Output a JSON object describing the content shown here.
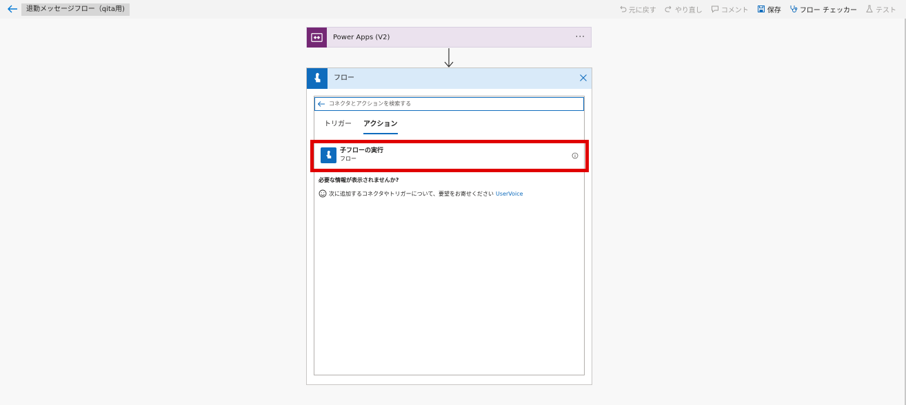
{
  "header": {
    "flow_name": "退勤メッセージフロー（qita用)",
    "toolbar": {
      "undo": "元に戻す",
      "redo": "やり直し",
      "comment": "コメント",
      "save": "保存",
      "flow_checker": "フロー チェッカー",
      "test": "テスト"
    }
  },
  "trigger_card": {
    "title": "Power Apps (V2)",
    "more": "···"
  },
  "flow_panel": {
    "title": "フロー",
    "search_placeholder": "コネクタとアクションを検索する",
    "tabs": [
      "トリガー",
      "アクション"
    ],
    "selected_tab": "アクション",
    "action": {
      "title": "子フローの実行",
      "subtitle": "フロー"
    },
    "need_info": "必要な情報が表示されませんか?",
    "suggest_text": "次に追加するコネクタやトリガーについて、要望をお寄せください",
    "suggest_link": "UserVoice"
  },
  "colors": {
    "accent": "#0f6cbd",
    "power_apps": "#742774",
    "highlight": "#e00000"
  }
}
